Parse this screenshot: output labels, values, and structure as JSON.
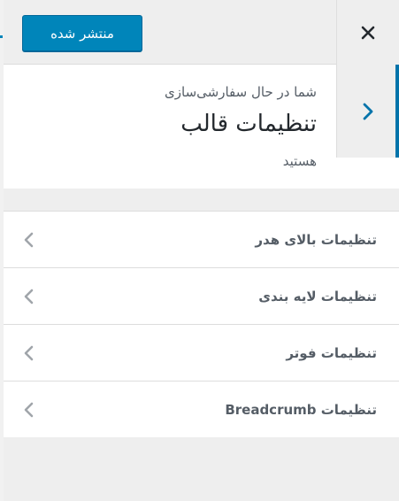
{
  "header": {
    "publish_label": "منتشر شده",
    "close_icon": "close-icon"
  },
  "info": {
    "pre": "شما در حال سفارشی‌سازی",
    "title": "تنظیمات قالب",
    "post": "هستید",
    "back_icon": "chevron-right-icon"
  },
  "sections": [
    {
      "label": "تنظیمات بالای هدر"
    },
    {
      "label": "تنظیمات لایه بندی"
    },
    {
      "label": "تنظیمات فوتر"
    },
    {
      "label": "تنظیمات Breadcrumb"
    }
  ],
  "colors": {
    "accent": "#0085ba",
    "accent_dark": "#0073aa",
    "panel_bg": "#eeeeee",
    "text": "#555d66"
  }
}
